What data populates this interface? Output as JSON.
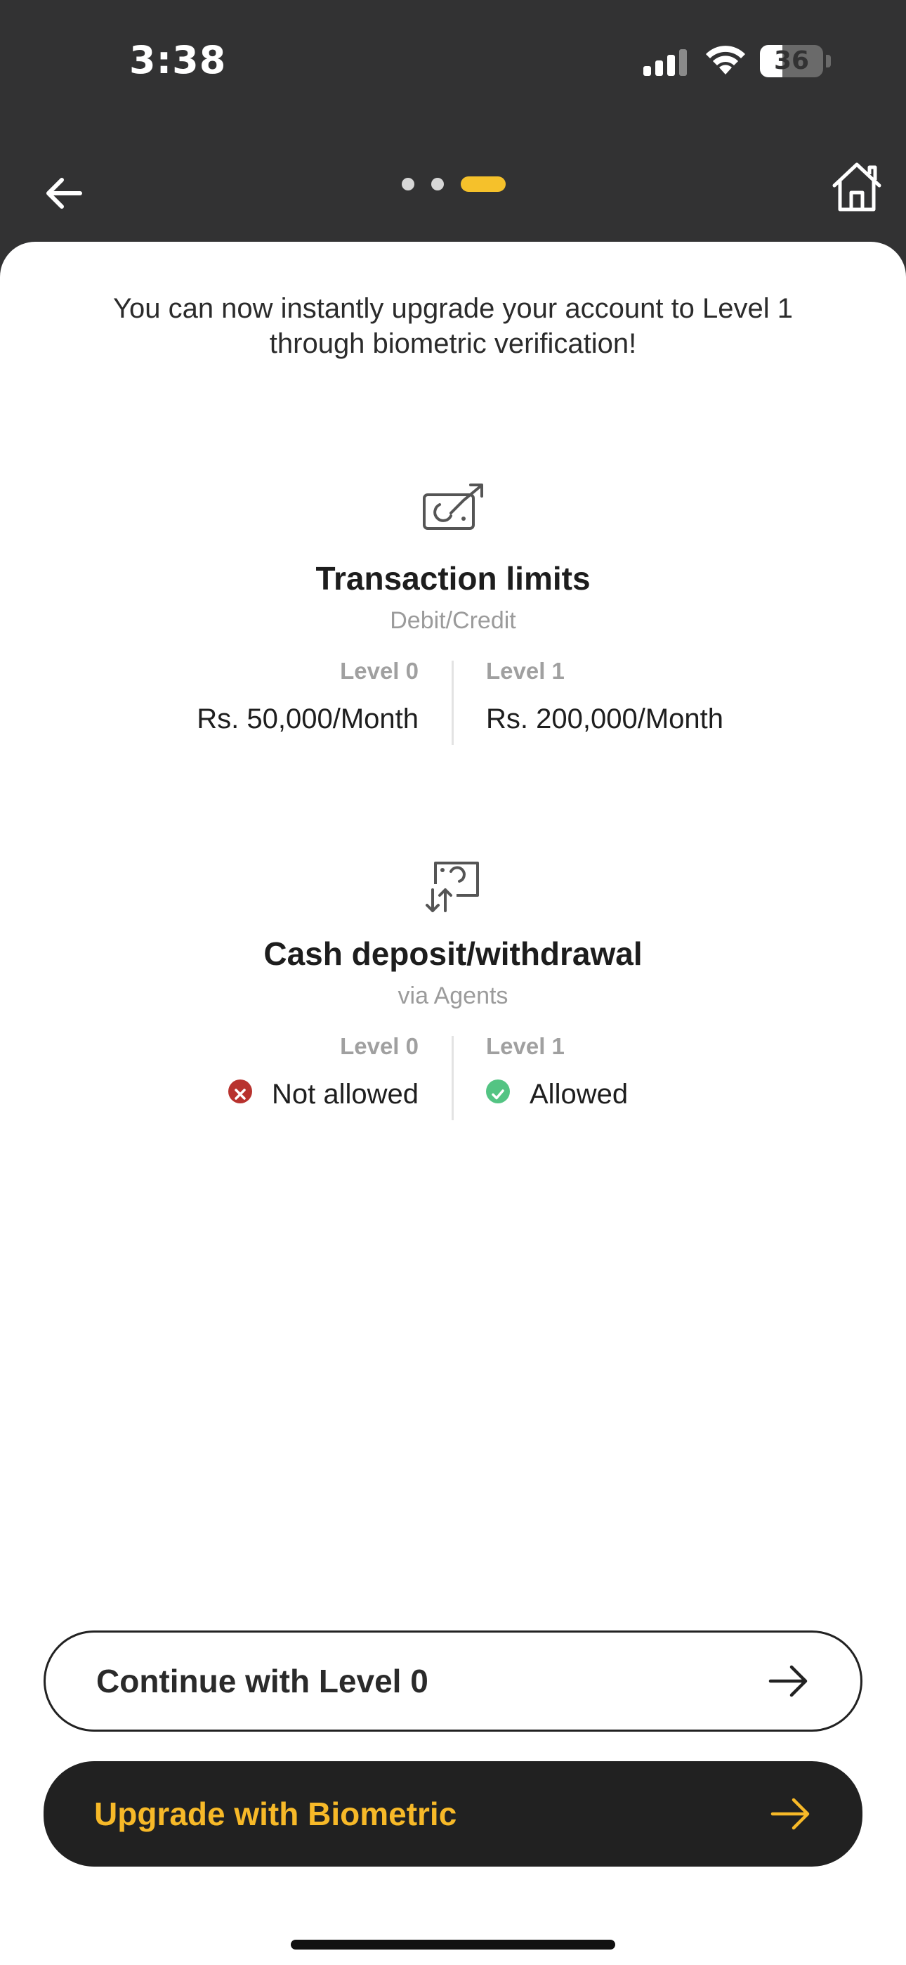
{
  "status_bar": {
    "time": "3:38",
    "battery_level": "36",
    "battery_fraction": 0.36
  },
  "nav": {
    "back_icon": "back-arrow-icon",
    "home_icon": "home-icon",
    "pager": {
      "pages": 3,
      "active_index": 2,
      "active_color": "#f5c12b"
    }
  },
  "intro": {
    "text": "You can now instantly upgrade your account to Level 1 through biometric verification!"
  },
  "features": [
    {
      "icon": "transaction-limits-icon",
      "title": "Transaction limits",
      "subtitle": "Debit/Credit",
      "left": {
        "label": "Level 0",
        "value": "Rs. 50,000/Month"
      },
      "right": {
        "label": "Level 1",
        "value": "Rs. 200,000/Month"
      }
    },
    {
      "icon": "cash-deposit-icon",
      "title": "Cash deposit/withdrawal",
      "subtitle": "via Agents",
      "left": {
        "label": "Level 0",
        "value": "Not allowed",
        "status_icon": "not-allowed-icon",
        "status_color": "#b8322e"
      },
      "right": {
        "label": "Level 1",
        "value": "Allowed",
        "status_icon": "allowed-icon",
        "status_color": "#53c483"
      }
    }
  ],
  "actions": {
    "continue_label": "Continue with Level 0",
    "upgrade_label": "Upgrade with Biometric",
    "arrow_icon": "arrow-right-icon",
    "accent_color": "#f7b928"
  }
}
